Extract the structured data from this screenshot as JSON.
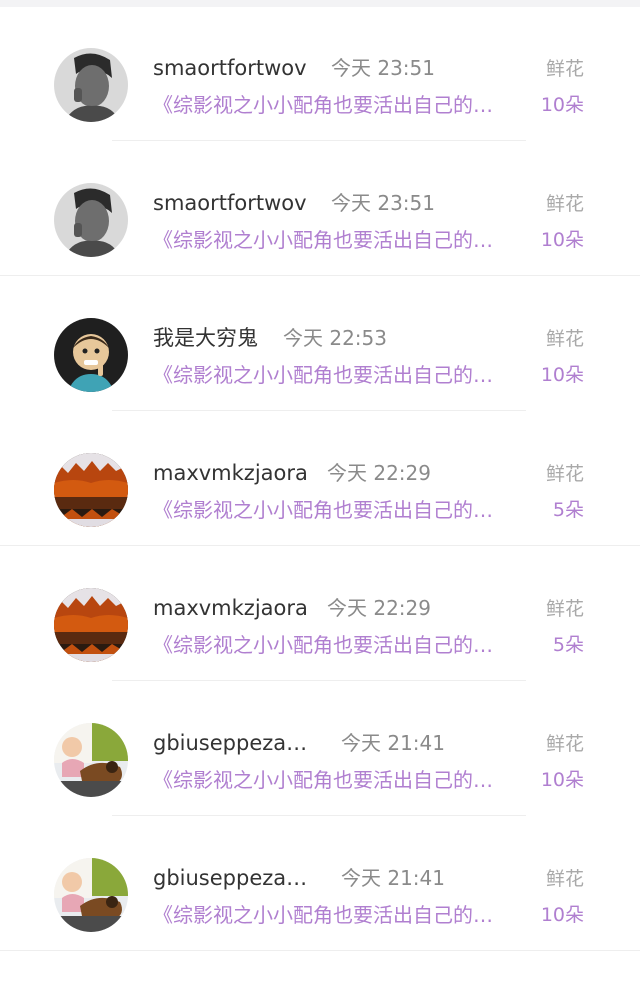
{
  "gift_records": [
    {
      "username": "smaortfortwov",
      "time": "今天 23:51",
      "title": "《综影视之小小配角也要活出自己的…",
      "gift_label": "鲜花",
      "gift_count": "10朵",
      "avatar": "man-portrait-avatar"
    },
    {
      "username": "smaortfortwov",
      "time": "今天 23:51",
      "title": "《综影视之小小配角也要活出自己的…",
      "gift_label": "鲜花",
      "gift_count": "10朵",
      "avatar": "man-portrait-avatar"
    },
    {
      "username": "我是大穷鬼",
      "time": "今天 22:53",
      "title": "《综影视之小小配角也要活出自己的…",
      "gift_label": "鲜花",
      "gift_count": "10朵",
      "avatar": "cartoon-character-avatar"
    },
    {
      "username": "maxvmkzjaora",
      "time": "今天 22:29",
      "title": "《综影视之小小配角也要活出自己的…",
      "gift_label": "鲜花",
      "gift_count": "5朵",
      "avatar": "autumn-landscape-avatar"
    },
    {
      "username": "maxvmkzjaora",
      "time": "今天 22:29",
      "title": "《综影视之小小配角也要活出自己的…",
      "gift_label": "鲜花",
      "gift_count": "5朵",
      "avatar": "autumn-landscape-avatar"
    },
    {
      "username": "gbiuseppeza…",
      "time": "今天 21:41",
      "title": "《综影视之小小配角也要活出自己的…",
      "gift_label": "鲜花",
      "gift_count": "10朵",
      "avatar": "baby-and-dog-avatar"
    },
    {
      "username": "gbiuseppeza…",
      "time": "今天 21:41",
      "title": "《综影视之小小配角也要活出自己的…",
      "gift_label": "鲜花",
      "gift_count": "10朵",
      "avatar": "baby-and-dog-avatar"
    }
  ],
  "colors": {
    "link_purple": "#b07fd0",
    "username": "#333333",
    "muted": "#8a8a8a"
  }
}
